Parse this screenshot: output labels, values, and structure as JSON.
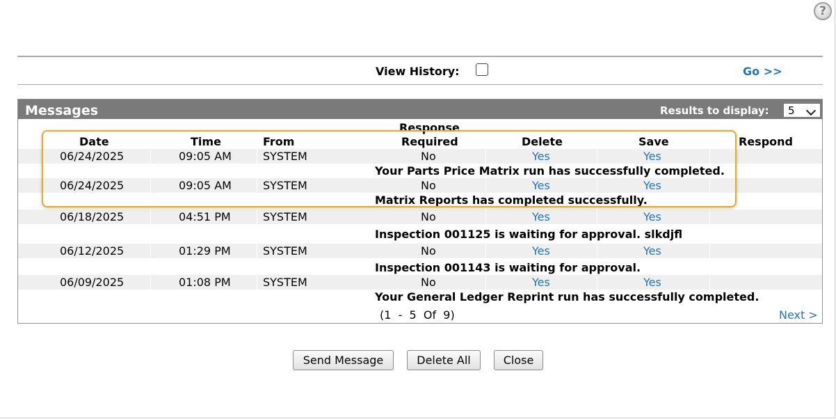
{
  "help_icon": {
    "glyph": "?"
  },
  "view_history": {
    "label": "View History:",
    "checked": false
  },
  "go_link": "Go >>",
  "panel": {
    "title": "Messages",
    "results_label": "Results to display:",
    "results_value": "5"
  },
  "columns": {
    "date": "Date",
    "time": "Time",
    "from": "From",
    "response_top": "Response",
    "response_bottom": "Required",
    "delete": "Delete",
    "save": "Save",
    "respond": "Respond"
  },
  "messages": [
    {
      "date": "06/24/2025",
      "time": "09:05 AM",
      "from": "SYSTEM",
      "response_required": "No",
      "delete": "Yes",
      "save": "Yes",
      "text": "Your Parts Price Matrix run has successfully completed.",
      "flagged": false
    },
    {
      "date": "06/24/2025",
      "time": "09:05 AM",
      "from": "SYSTEM",
      "response_required": "No",
      "delete": "Yes",
      "save": "Yes",
      "text": "Matrix Reports has completed successfully.",
      "flagged": false
    },
    {
      "date": "06/18/2025",
      "time": "04:51 PM",
      "from": "SYSTEM",
      "response_required": "No",
      "delete": "Yes",
      "save": "Yes",
      "text": "Inspection 001125 is waiting for approval. slkdjfl",
      "flagged": true
    },
    {
      "date": "06/12/2025",
      "time": "01:29 PM",
      "from": "SYSTEM",
      "response_required": "No",
      "delete": "Yes",
      "save": "Yes",
      "text": "Inspection 001143 is waiting for approval.",
      "flagged": true
    },
    {
      "date": "06/09/2025",
      "time": "01:08 PM",
      "from": "SYSTEM",
      "response_required": "No",
      "delete": "Yes",
      "save": "Yes",
      "text": "Your General Ledger Reprint run has successfully completed.",
      "flagged": false
    }
  ],
  "pager": {
    "text": "(1  -  5  Of  9)",
    "next": "Next >"
  },
  "buttons": {
    "send": "Send Message",
    "delete_all": "Delete All",
    "close": "Close"
  },
  "colors": {
    "link": "#1f75b8",
    "header_bar": "#7a7a7a",
    "highlight": "#f0a81e",
    "flag": "#d9262b",
    "row_shade": "#efefef"
  }
}
